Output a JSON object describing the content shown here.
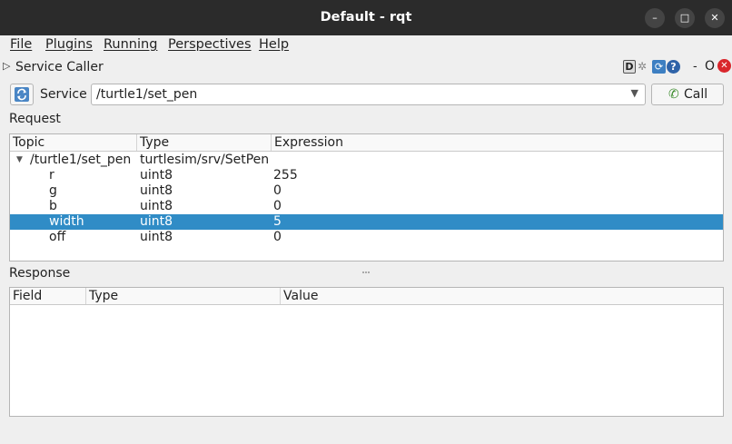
{
  "window": {
    "title": "Default - rqt",
    "minimize_glyph": "–",
    "maximize_glyph": "□",
    "close_glyph": "✕"
  },
  "menu": [
    "File",
    "Plugins",
    "Running",
    "Perspectives",
    "Help"
  ],
  "plugin": {
    "title": "Service Caller",
    "dock_buttons": [
      "D",
      "O"
    ]
  },
  "service_row": {
    "label": "Service",
    "selected_service": "/turtle1/set_pen",
    "call_label": "Call"
  },
  "request": {
    "label": "Request",
    "columns": [
      "Topic",
      "Type",
      "Expression"
    ],
    "rows": [
      {
        "topic": "/turtle1/set_pen",
        "type": "turtlesim/srv/SetPen",
        "expression": "",
        "expanded": true,
        "level": 0,
        "selected": false
      },
      {
        "topic": "r",
        "type": "uint8",
        "expression": "255",
        "level": 1,
        "selected": false
      },
      {
        "topic": "g",
        "type": "uint8",
        "expression": "0",
        "level": 1,
        "selected": false
      },
      {
        "topic": "b",
        "type": "uint8",
        "expression": "0",
        "level": 1,
        "selected": false
      },
      {
        "topic": "width",
        "type": "uint8",
        "expression": "5",
        "level": 1,
        "selected": true
      },
      {
        "topic": "off",
        "type": "uint8",
        "expression": "0",
        "level": 1,
        "selected": false
      }
    ]
  },
  "response": {
    "label": "Response",
    "columns": [
      "Field",
      "Type",
      "Value"
    ],
    "rows": []
  },
  "colors": {
    "titlebar": "#2b2b2b",
    "selection": "#308cc6",
    "close_red": "#d9262c"
  }
}
